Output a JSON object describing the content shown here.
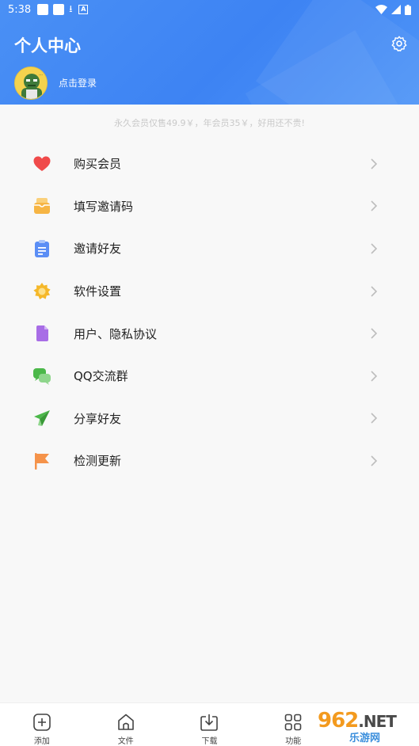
{
  "status_bar": {
    "time": "5:38",
    "download_glyph": "⭳",
    "a_glyph": "A"
  },
  "header": {
    "title": "个人中心",
    "login_text": "点击登录"
  },
  "promo_text": "永久会员仅售49.9￥，年会员35￥，好用还不贵!",
  "menu": [
    {
      "label": "购买会员",
      "icon": "heart-icon",
      "color": "#f04a4a"
    },
    {
      "label": "填写邀请码",
      "icon": "mailbox-icon",
      "color": "#f6b544"
    },
    {
      "label": "邀请好友",
      "icon": "clipboard-icon",
      "color": "#5b8ef5"
    },
    {
      "label": "软件设置",
      "icon": "sun-gear-icon",
      "color": "#f5b82a"
    },
    {
      "label": "用户、隐私协议",
      "icon": "document-icon",
      "color": "#a86de6"
    },
    {
      "label": "QQ交流群",
      "icon": "chat-bubbles-icon",
      "color": "#4cb84a"
    },
    {
      "label": "分享好友",
      "icon": "paper-plane-icon",
      "color": "#4cb84a"
    },
    {
      "label": "检测更新",
      "icon": "flag-icon",
      "color": "#f5934a"
    }
  ],
  "tabbar": {
    "items": [
      {
        "label": "添加",
        "icon": "add-square-icon"
      },
      {
        "label": "文件",
        "icon": "home-icon"
      },
      {
        "label": "下载",
        "icon": "download-tray-icon"
      },
      {
        "label": "功能",
        "icon": "grid-icon"
      }
    ]
  },
  "watermark": {
    "logo_main": "962",
    "logo_net": ".NET",
    "sub": "乐游网"
  },
  "colors": {
    "header_blue": "#3d83f3",
    "background": "#f8f8f8",
    "chevron": "#bdbdbd"
  }
}
